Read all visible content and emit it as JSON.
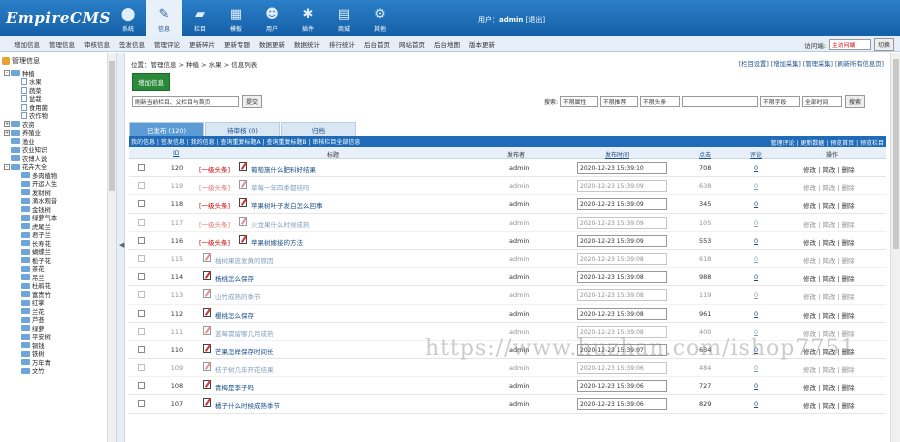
{
  "header": {
    "logo": "EmpireCMS",
    "nav": [
      {
        "label": "系统",
        "icon": "system-icon"
      },
      {
        "label": "信息",
        "icon": "info-icon",
        "active": true
      },
      {
        "label": "栏目",
        "icon": "folder-icon"
      },
      {
        "label": "模板",
        "icon": "template-icon"
      },
      {
        "label": "用户",
        "icon": "user-icon"
      },
      {
        "label": "插件",
        "icon": "plugin-icon"
      },
      {
        "label": "商城",
        "icon": "shop-icon"
      },
      {
        "label": "其他",
        "icon": "gear-icon"
      }
    ],
    "user_label": "用户：",
    "username": "admin",
    "logout": "[退出]"
  },
  "menubar": {
    "items": [
      "增加信息",
      "管理信息",
      "审核信息",
      "签发信息",
      "管理评论",
      "更新碎片",
      "更新专题",
      "数据更新",
      "数据统计",
      "排行统计",
      "后台首页",
      "网站首页",
      "后台地图",
      "版本更新"
    ],
    "visit_label": "访问端:",
    "visit_value": "主访问端",
    "switch_button": "切换"
  },
  "sidebar": {
    "root": "管理信息",
    "nodes": [
      {
        "label": "种植",
        "type": "folder",
        "level": 0,
        "toggle": "-"
      },
      {
        "label": "水果",
        "type": "doc",
        "level": 1
      },
      {
        "label": "蔬菜",
        "type": "doc",
        "level": 1
      },
      {
        "label": "盆栽",
        "type": "doc",
        "level": 1
      },
      {
        "label": "食用菌",
        "type": "doc",
        "level": 1
      },
      {
        "label": "农作物",
        "type": "doc",
        "level": 1
      },
      {
        "label": "农资",
        "type": "folder",
        "level": 0,
        "toggle": "+"
      },
      {
        "label": "养殖业",
        "type": "folder",
        "level": 0,
        "toggle": "+"
      },
      {
        "label": "渔业",
        "type": "folder",
        "level": 0
      },
      {
        "label": "农业知识",
        "type": "folder",
        "level": 0
      },
      {
        "label": "农博人说",
        "type": "folder",
        "level": 0
      },
      {
        "label": "花卉大全",
        "type": "folder",
        "level": 0,
        "toggle": "-"
      },
      {
        "label": "多肉植物",
        "type": "folder",
        "level": 1
      },
      {
        "label": "开运人生",
        "type": "folder",
        "level": 1
      },
      {
        "label": "发财树",
        "type": "folder",
        "level": 1
      },
      {
        "label": "滴水观音",
        "type": "folder",
        "level": 1
      },
      {
        "label": "金钱树",
        "type": "folder",
        "level": 1
      },
      {
        "label": "绿萝气本",
        "type": "folder",
        "level": 1
      },
      {
        "label": "虎尾兰",
        "type": "folder",
        "level": 1
      },
      {
        "label": "君子兰",
        "type": "folder",
        "level": 1
      },
      {
        "label": "长寿花",
        "type": "folder",
        "level": 1
      },
      {
        "label": "蝴蝶兰",
        "type": "folder",
        "level": 1
      },
      {
        "label": "栀子花",
        "type": "folder",
        "level": 1
      },
      {
        "label": "茶花",
        "type": "folder",
        "level": 1
      },
      {
        "label": "吊兰",
        "type": "folder",
        "level": 1
      },
      {
        "label": "杜鹃花",
        "type": "folder",
        "level": 1
      },
      {
        "label": "富贵竹",
        "type": "folder",
        "level": 1
      },
      {
        "label": "红掌",
        "type": "folder",
        "level": 1
      },
      {
        "label": "兰花",
        "type": "folder",
        "level": 1
      },
      {
        "label": "芦荟",
        "type": "folder",
        "level": 1
      },
      {
        "label": "绿萝",
        "type": "folder",
        "level": 1
      },
      {
        "label": "平安树",
        "type": "folder",
        "level": 1
      },
      {
        "label": "铜钱",
        "type": "folder",
        "level": 1
      },
      {
        "label": "铁树",
        "type": "folder",
        "level": 1
      },
      {
        "label": "万年青",
        "type": "folder",
        "level": 1
      },
      {
        "label": "文竹",
        "type": "folder",
        "level": 1
      }
    ]
  },
  "main": {
    "breadcrumb": "位置：管理信息 > 种植 > 水果 > 信息列表",
    "top_links": "[栏目设置] [增加采集] [管理采集] [刷新所有信息页]",
    "add_button": "增加信息",
    "filter": {
      "column_select": "刷新当前栏目、父栏目与首页",
      "submit_button": "提交",
      "search_label": "搜索:",
      "selects": [
        "不限属性",
        "不限推荐",
        "不限头条"
      ],
      "field_select": "不限字段",
      "time_select": "全部时间",
      "search_button": "搜索"
    },
    "tabs": [
      {
        "label": "已发布 (120)",
        "active": true
      },
      {
        "label": "待审核 (0)",
        "active": false
      },
      {
        "label": "归档",
        "active": false
      }
    ],
    "action_links": "我的信息 | 签发信息 | 我的信息 | 查询重复标题A | 查询重复标题B | 审核栏目全部信息",
    "action_links_right": "管理评论 | 更新数据 | 预览首页 | 预览栏目",
    "columns": {
      "id": "ID",
      "title": "标题",
      "author": "发布者",
      "time": "发布时间",
      "clicks": "点击",
      "comments": "评论",
      "ops": "操作"
    },
    "rows": [
      {
        "id": "120",
        "tag": "[一级头条]",
        "title": "葡萄施什么肥料好结果",
        "author": "admin",
        "time": "2020-12-23 15:39:10",
        "clicks": "708",
        "comments": "0",
        "ops": "修改 | 简改 | 删除",
        "faded": false
      },
      {
        "id": "119",
        "tag": "[一级头条]",
        "title": "草莓一年四季都结吗",
        "author": "admin",
        "time": "2020-12-23 15:39:09",
        "clicks": "638",
        "comments": "0",
        "ops": "修改 | 简改 | 删除",
        "faded": true
      },
      {
        "id": "118",
        "tag": "[一级头条]",
        "title": "苹果树叶子发白怎么回事",
        "author": "admin",
        "time": "2020-12-23 15:39:09",
        "clicks": "345",
        "comments": "0",
        "ops": "修改 | 简改 | 删除",
        "faded": false
      },
      {
        "id": "117",
        "tag": "[一级头条]",
        "title": "火龙果什么时候成熟",
        "author": "admin",
        "time": "2020-12-23 15:39:09",
        "clicks": "105",
        "comments": "0",
        "ops": "修改 | 简改 | 删除",
        "faded": true
      },
      {
        "id": "116",
        "tag": "[一级头条]",
        "title": "苹果树嫁接的方法",
        "author": "admin",
        "time": "2020-12-23 15:39:09",
        "clicks": "553",
        "comments": "0",
        "ops": "修改 | 简改 | 删除",
        "faded": false
      },
      {
        "id": "115",
        "tag": "",
        "title": "柚树果皮发黄的原因",
        "author": "admin",
        "time": "2020-12-23 15:39:08",
        "clicks": "618",
        "comments": "0",
        "ops": "修改 | 简改 | 删除",
        "faded": true
      },
      {
        "id": "114",
        "tag": "",
        "title": "杨桃怎么保存",
        "author": "admin",
        "time": "2020-12-23 15:39:08",
        "clicks": "988",
        "comments": "0",
        "ops": "修改 | 简改 | 删除",
        "faded": false
      },
      {
        "id": "113",
        "tag": "",
        "title": "山竹成熟的季节",
        "author": "admin",
        "time": "2020-12-23 15:39:08",
        "clicks": "119",
        "comments": "0",
        "ops": "修改 | 简改 | 删除",
        "faded": true
      },
      {
        "id": "112",
        "tag": "",
        "title": "樱桃怎么保存",
        "author": "admin",
        "time": "2020-12-23 15:39:08",
        "clicks": "961",
        "comments": "0",
        "ops": "修改 | 简改 | 删除",
        "faded": false
      },
      {
        "id": "111",
        "tag": "",
        "title": "蓝莓需留哪几月成熟",
        "author": "admin",
        "time": "2020-12-23 15:39:08",
        "clicks": "400",
        "comments": "0",
        "ops": "修改 | 简改 | 删除",
        "faded": true
      },
      {
        "id": "110",
        "tag": "",
        "title": "芒果怎样保存时间长",
        "author": "admin",
        "time": "2020-12-23 15:39:07",
        "clicks": "634",
        "comments": "0",
        "ops": "修改 | 简改 | 删除",
        "faded": false
      },
      {
        "id": "109",
        "tag": "",
        "title": "桔子树几年开花结果",
        "author": "admin",
        "time": "2020-12-23 15:39:06",
        "clicks": "484",
        "comments": "0",
        "ops": "修改 | 简改 | 删除",
        "faded": true
      },
      {
        "id": "108",
        "tag": "",
        "title": "青梅是李子吗",
        "author": "admin",
        "time": "2020-12-23 15:39:06",
        "clicks": "727",
        "comments": "0",
        "ops": "修改 | 简改 | 删除",
        "faded": false
      },
      {
        "id": "107",
        "tag": "",
        "title": "橘子什么时候成熟季节",
        "author": "admin",
        "time": "2020-12-23 15:39:06",
        "clicks": "829",
        "comments": "0",
        "ops": "修改 | 简改 | 删除",
        "faded": false
      }
    ]
  },
  "watermark": "https://www.huzhan.com/ishop7751"
}
